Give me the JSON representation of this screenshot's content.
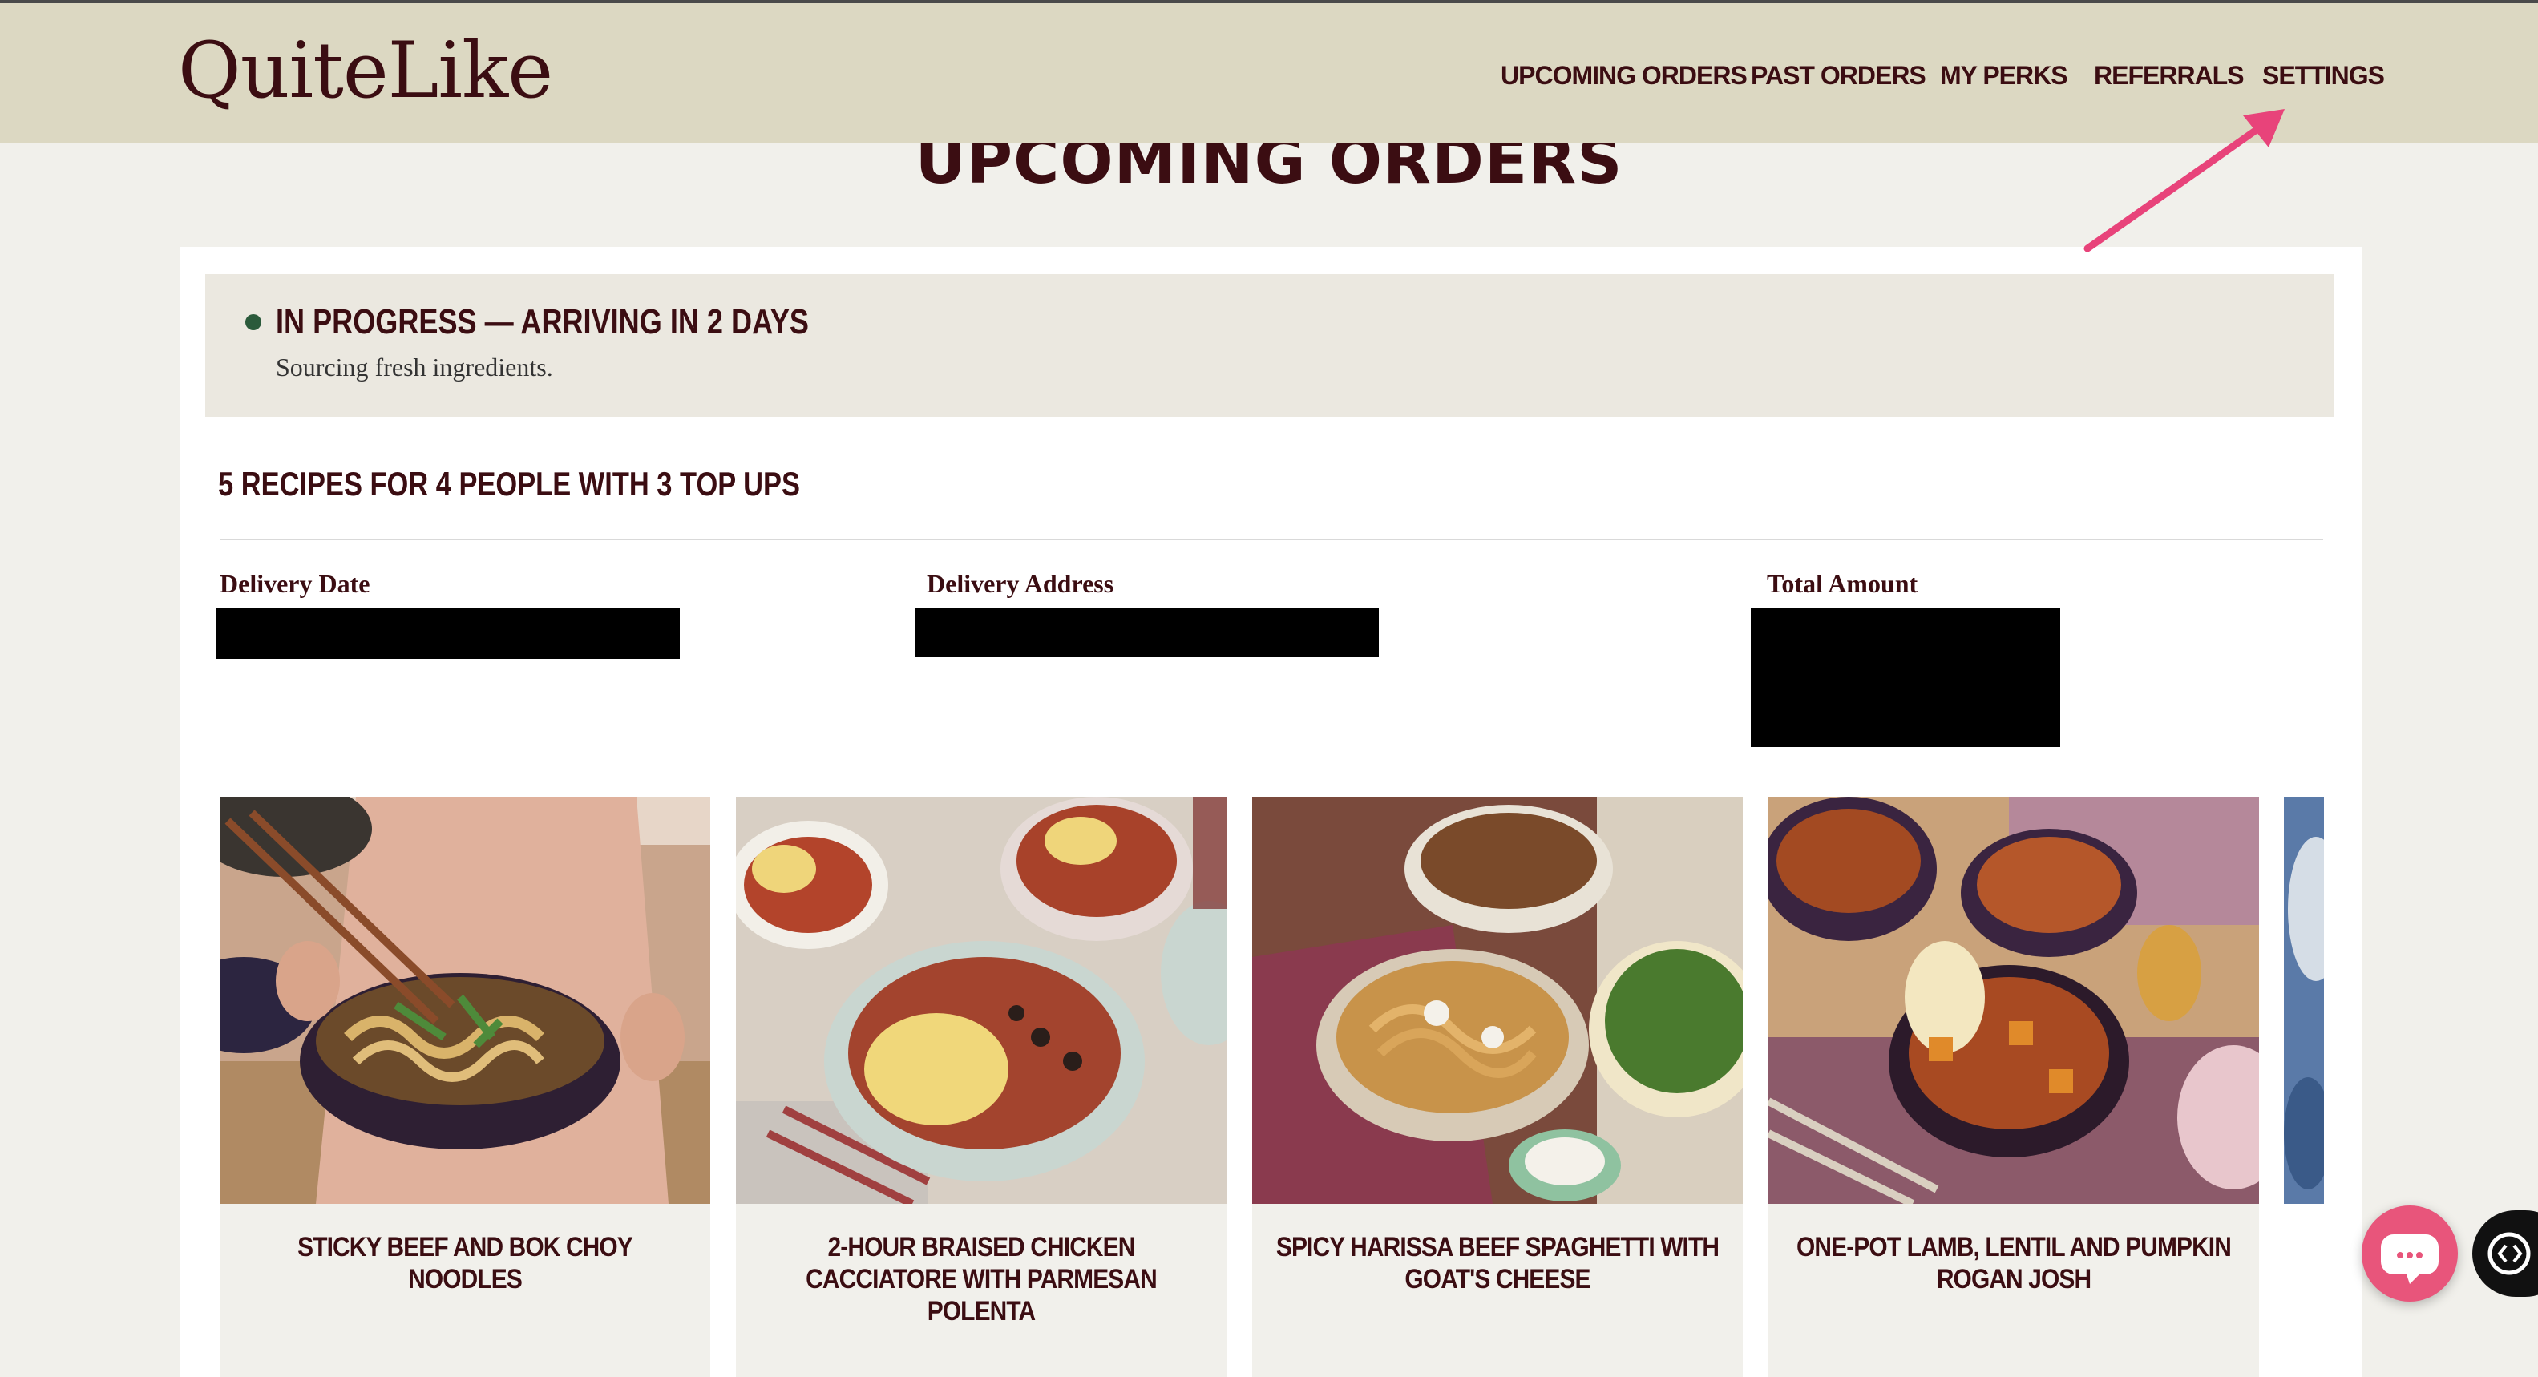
{
  "brand": {
    "logo_text": "QuiteLike"
  },
  "nav": {
    "items": [
      {
        "label": "UPCOMING ORDERS",
        "active": true
      },
      {
        "label": "PAST ORDERS",
        "active": false
      },
      {
        "label": "MY PERKS",
        "active": false
      },
      {
        "label": "REFERRALS",
        "active": false
      },
      {
        "label": "SETTINGS",
        "active": false
      }
    ]
  },
  "page": {
    "heading": "UPCOMING ORDERS"
  },
  "order": {
    "status_title": "IN PROGRESS — ARRIVING IN 2 DAYS",
    "status_subtitle": "Sourcing fresh ingredients.",
    "summary": "5 RECIPES FOR 4 PEOPLE WITH 3 TOP UPS",
    "details": {
      "delivery_date_label": "Delivery Date",
      "delivery_address_label": "Delivery Address",
      "total_amount_label": "Total Amount"
    }
  },
  "recipes": [
    {
      "title": "STICKY BEEF AND BOK CHOY NOODLES"
    },
    {
      "title": "2-HOUR BRAISED CHICKEN CACCIATORE WITH PARMESAN POLENTA"
    },
    {
      "title": "SPICY HARISSA BEEF SPAGHETTI WITH GOAT'S CHEESE"
    },
    {
      "title": "ONE-POT LAMB, LENTIL AND PUMPKIN ROGAN JOSH"
    }
  ],
  "colors": {
    "header_bg": "#dcd8c2",
    "brand_maroon": "#3b0d12",
    "status_dot": "#2b5a3b",
    "annotation_arrow": "#e8437a",
    "chat_button": "#e8557b"
  },
  "icons": {
    "chat": "chat-bubble-icon",
    "side_widget": "code-brackets-icon"
  }
}
